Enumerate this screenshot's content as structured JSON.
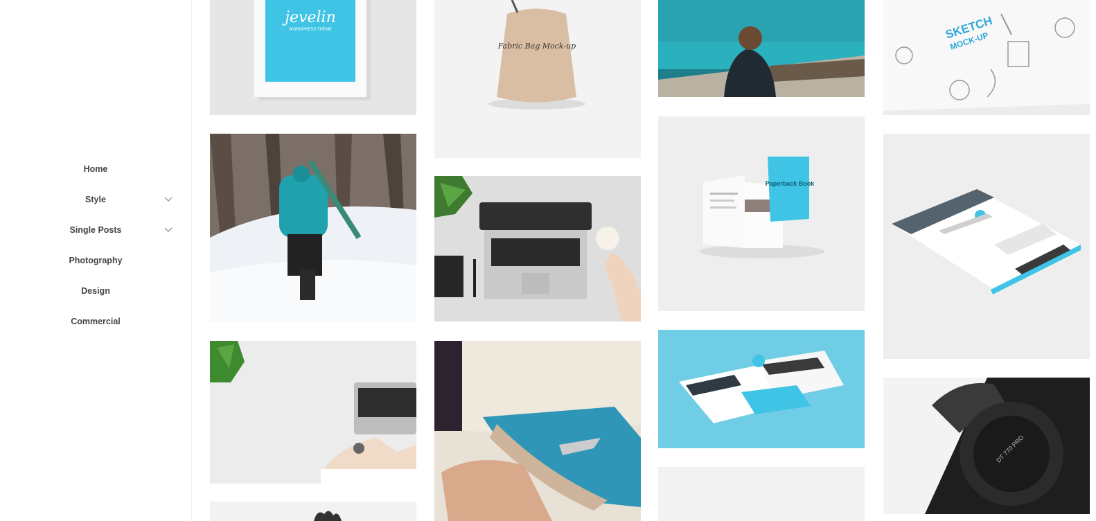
{
  "nav": {
    "items": [
      {
        "label": "Home",
        "has_submenu": false
      },
      {
        "label": "Style",
        "has_submenu": true
      },
      {
        "label": "Single Posts",
        "has_submenu": true
      },
      {
        "label": "Photography",
        "has_submenu": false
      },
      {
        "label": "Design",
        "has_submenu": false
      },
      {
        "label": "Commercial",
        "has_submenu": false
      }
    ]
  },
  "tiles": {
    "frame_logo": "jevelin",
    "frame_sub": "WORDPRESS THEME",
    "bag_text": "Fabric Bag Mock-up",
    "sketch_line1": "SKETCH",
    "sketch_line2": "MOCK-UP",
    "book_title": "Paperback Book",
    "headphones_text": "DT 770 PRO"
  },
  "colors": {
    "accent": "#3fc4e6",
    "nav_text": "#444444"
  }
}
